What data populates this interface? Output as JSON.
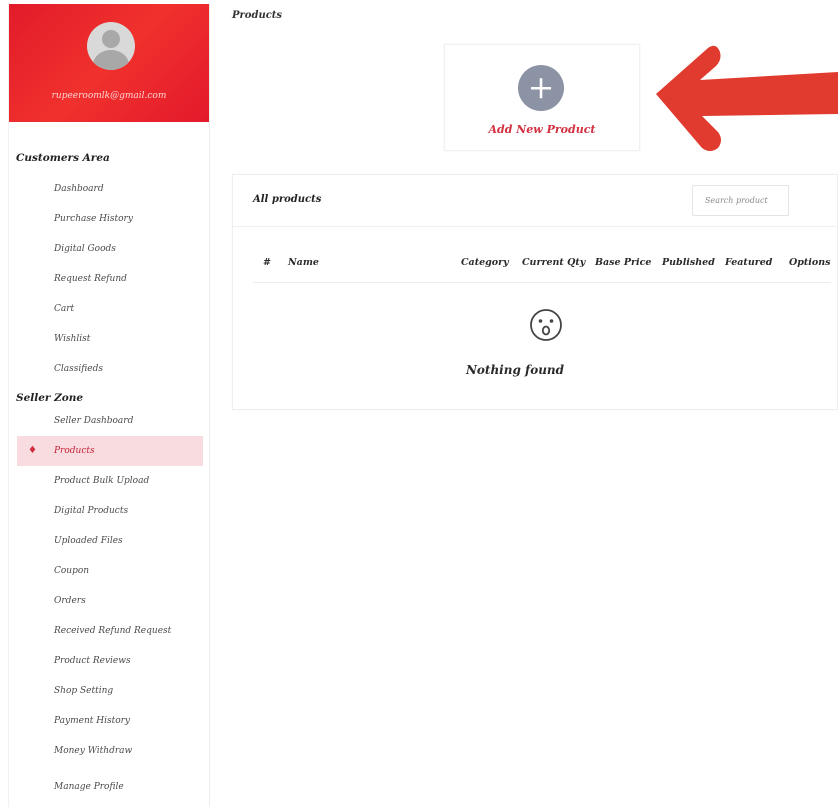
{
  "sidebar": {
    "email": "rupeeroomlk@gmail.com",
    "customers_title": "Customers Area",
    "customers_items": [
      {
        "label": "Dashboard"
      },
      {
        "label": "Purchase History"
      },
      {
        "label": "Digital Goods"
      },
      {
        "label": "Request Refund"
      },
      {
        "label": "Cart"
      },
      {
        "label": "Wishlist"
      },
      {
        "label": "Classifieds"
      }
    ],
    "seller_title": "Seller Zone",
    "seller_items": [
      {
        "label": "Seller Dashboard"
      },
      {
        "label": "Products",
        "active": true
      },
      {
        "label": "Product Bulk Upload"
      },
      {
        "label": "Digital Products"
      },
      {
        "label": "Uploaded Files"
      },
      {
        "label": "Coupon"
      },
      {
        "label": "Orders"
      },
      {
        "label": "Received Refund Request"
      },
      {
        "label": "Product Reviews"
      },
      {
        "label": "Shop Setting"
      },
      {
        "label": "Payment History"
      },
      {
        "label": "Money Withdraw"
      }
    ],
    "manage_profile": "Manage Profile"
  },
  "main": {
    "page_title": "Products",
    "add_product_label": "Add New Product",
    "card_title": "All products",
    "search_placeholder": "Search product",
    "columns": [
      "#",
      "Name",
      "Category",
      "Current Qty",
      "Base Price",
      "Published",
      "Featured",
      "Options"
    ],
    "empty_text": "Nothing found"
  },
  "colors": {
    "brand_red": "#e21b2a",
    "active_bg": "#f8dcdf",
    "arrow_red": "#e03b2e",
    "plus_circle": "#8c93a5"
  },
  "icons": {
    "avatar": "user-avatar-icon",
    "products": "diamond-icon",
    "add": "plus-icon",
    "empty": "surprised-face-icon",
    "arrow": "left-arrow-annotation"
  }
}
